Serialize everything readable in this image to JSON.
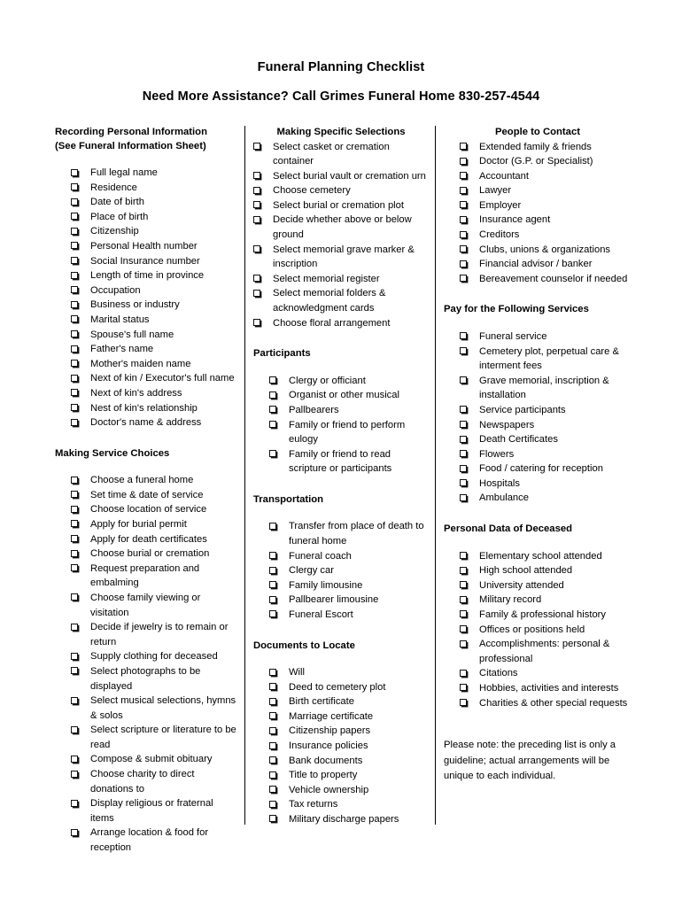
{
  "document": {
    "title": "Funeral Planning Checklist",
    "subtitle": "Need More Assistance? Call Grimes Funeral Home 830-257-4544",
    "note": "Please note: the preceding list is only a guideline; actual arrangements will be unique to each individual."
  },
  "columns": {
    "column1": {
      "sections": [
        {
          "heading": "Recording Personal Information",
          "heading_line2": "(See Funeral Information Sheet)",
          "items": [
            "Full legal name",
            "Residence",
            "Date of birth",
            "Place of birth",
            "Citizenship",
            "Personal Health number",
            "Social Insurance number",
            "Length of time in province",
            "Occupation",
            "Business or industry",
            "Marital status",
            "Spouse's full name",
            "Father's name",
            "Mother's maiden name",
            "Next of kin / Executor's full name",
            "Next of kin's address",
            "Nest of kin's relationship",
            "Doctor's name & address"
          ]
        },
        {
          "heading": "Making Service Choices",
          "items": [
            "Choose a funeral home",
            "Set time & date of service",
            "Choose location of service",
            "Apply for burial permit",
            "Apply for death certificates",
            "Choose burial or cremation",
            "Request preparation and embalming",
            "Choose family viewing or visitation",
            "Decide if jewelry is to remain or return",
            "Supply clothing for deceased",
            "Select photographs to be displayed",
            "Select musical selections, hymns & solos",
            "Select scripture or literature to be read",
            "Compose & submit obituary",
            "Choose charity to direct donations to",
            "Display religious or fraternal items",
            "Arrange location & food for reception"
          ]
        }
      ]
    },
    "column2": {
      "sections": [
        {
          "heading": "Making Specific Selections",
          "items": [
            "Select casket or cremation container",
            "Select burial vault or cremation urn",
            "Choose cemetery",
            "Select burial or cremation plot",
            "Decide whether above or below ground",
            "Select memorial grave marker & inscription",
            "Select memorial register",
            "Select memorial folders & acknowledgment cards",
            "Choose floral arrangement"
          ]
        },
        {
          "heading": "Participants",
          "items": [
            "Clergy or officiant",
            "Organist or other musical",
            "Pallbearers",
            "Family or friend to perform eulogy",
            "Family or friend to read scripture or participants"
          ]
        },
        {
          "heading": "Transportation",
          "items": [
            "Transfer from place of death to funeral home",
            "Funeral coach",
            "Clergy car",
            "Family limousine",
            "Pallbearer limousine",
            "Funeral Escort"
          ]
        },
        {
          "heading": "Documents to Locate",
          "items": [
            "Will",
            "Deed to cemetery plot",
            "Birth certificate",
            "Marriage certificate",
            "Citizenship papers",
            "Insurance policies",
            "Bank documents",
            "Title to property",
            "Vehicle ownership",
            "Tax returns",
            "Military discharge papers"
          ]
        }
      ]
    },
    "column3": {
      "sections": [
        {
          "heading": "People to Contact",
          "items": [
            "Extended family & friends",
            "Doctor (G.P. or Specialist)",
            "Accountant",
            "Lawyer",
            "Employer",
            "Insurance agent",
            "Creditors",
            "Clubs, unions & organizations",
            "Financial advisor / banker",
            "Bereavement counselor if needed"
          ]
        },
        {
          "heading": "Pay for the Following Services",
          "items": [
            "Funeral service",
            "Cemetery plot, perpetual care & interment fees",
            "Grave memorial, inscription & installation",
            "Service participants",
            "Newspapers",
            "Death Certificates",
            "Flowers",
            "Food / catering for reception",
            "Hospitals",
            "Ambulance"
          ]
        },
        {
          "heading": "Personal Data of Deceased",
          "items": [
            "Elementary school attended",
            "High school attended",
            "University attended",
            "Military record",
            "Family & professional history",
            "Offices or positions held",
            "Accomplishments: personal & professional",
            "Citations",
            "Hobbies, activities and interests",
            "Charities & other special requests"
          ]
        }
      ]
    }
  },
  "colors": {
    "text": "#000000",
    "background": "#ffffff",
    "divider": "#000000"
  }
}
